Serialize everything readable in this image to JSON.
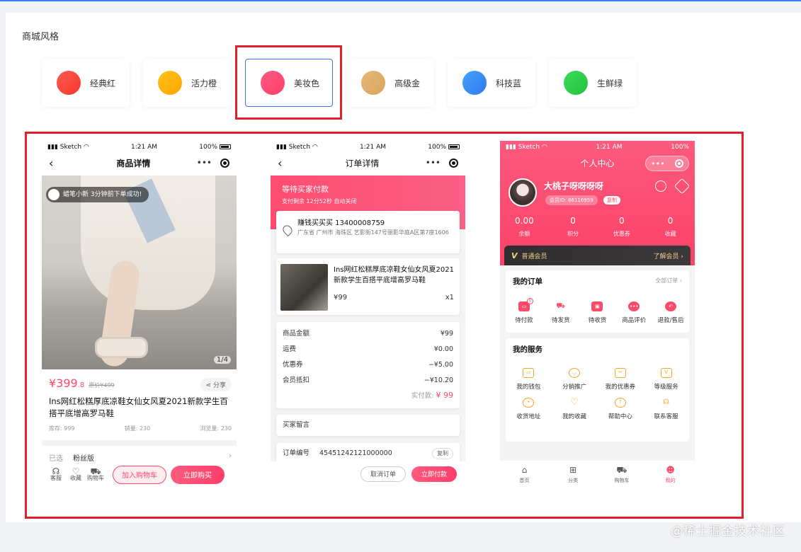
{
  "section_title": "商城风格",
  "themes": [
    {
      "name": "经典红",
      "color": "#f5392f",
      "color2": "#ff5a4e"
    },
    {
      "name": "活力橙",
      "color": "#ffa600",
      "color2": "#ffc21a"
    },
    {
      "name": "美妆色",
      "color": "#fb3f6a",
      "color2": "#fd5a80"
    },
    {
      "name": "高级金",
      "color": "#d9a45f",
      "color2": "#e6b878"
    },
    {
      "name": "科技蓝",
      "color": "#2f7af0",
      "color2": "#46a3f6"
    },
    {
      "name": "生鲜绿",
      "color": "#1fc43e",
      "color2": "#3ed95a"
    }
  ],
  "selected_theme": "美妆色",
  "phone1": {
    "status": {
      "carrier": "Sketch",
      "time": "1:21 AM",
      "battery": "100%"
    },
    "nav_title": "商品详情",
    "toast": "蜡笔小新 3分钟前下单成功!",
    "pager": "1/4",
    "price_main": "¥399",
    "price_dec": ".8",
    "orig_price": "原价¥499",
    "share": "分享",
    "title": "Ins网红松糕厚底凉鞋女仙女风夏2021新款学生百搭平底增高罗马鞋",
    "stock": "库存: 999",
    "sales": "销量: 230",
    "views": "浏览量: 230",
    "selected_label": "已选",
    "selected_value": "粉丝版",
    "bottom": {
      "service": "客服",
      "fav": "收藏",
      "cart": "购物车",
      "add_cart": "加入购物车",
      "buy": "立即购买"
    }
  },
  "phone2": {
    "status": {
      "carrier": "Sketch",
      "time": "1:21 AM",
      "battery": "100%"
    },
    "nav_title": "订单详情",
    "header_title": "等待买家付款",
    "header_sub": "支付剩余 12分52秒 自动关闭",
    "buyer": "赚钱买买买  13400008759",
    "address": "广东省 广州市 海珠区 艺影街147号丽影华庭A区第7座1606",
    "goods_title": "Ins网红松糕厚底凉鞋女仙女风夏2021新款学生百搭平底增高罗马鞋",
    "goods_price": "¥99",
    "goods_qty": "x1",
    "fees": [
      {
        "label": "商品金额",
        "value": "¥99"
      },
      {
        "label": "运费",
        "value": "¥0.00"
      },
      {
        "label": "优惠券",
        "value": "−¥5.00"
      },
      {
        "label": "会员抵扣",
        "value": "−¥10.20"
      }
    ],
    "total_label": "实付款: ",
    "total_value": "¥ 99",
    "message_label": "买家留言",
    "order_no_label": "订单编号",
    "order_no": "45451242121000000",
    "copy": "复制",
    "cancel": "取消订单",
    "pay": "立即付款"
  },
  "phone3": {
    "status": {
      "carrier": "Sketch",
      "time": "1:21 AM",
      "battery": "100%"
    },
    "nav_title": "个人中心",
    "username": "大桃子呀呀呀呀",
    "member_id": "会员ID: 86116959",
    "copy": "复制",
    "assets": [
      {
        "value": "0.00",
        "label": "余额"
      },
      {
        "value": "0",
        "label": "积分"
      },
      {
        "value": "0",
        "label": "优惠券"
      },
      {
        "value": "0",
        "label": "收藏"
      }
    ],
    "vip_label": "普通会员",
    "vip_more": "了解会员 ›",
    "orders_title": "我的订单",
    "orders_more": "全部订单 ›",
    "orders": [
      "待付款",
      "待发货",
      "待收货",
      "商品评价",
      "退款/售后"
    ],
    "orders_badge": "5",
    "services_title": "我的服务",
    "services": [
      "我的钱包",
      "分销推广",
      "我的优惠券",
      "等级服务",
      "收货地址",
      "我的收藏",
      "帮助中心",
      "联系客服"
    ],
    "tabs": [
      "首页",
      "分类",
      "购物车",
      "我的"
    ]
  },
  "watermark": "@稀土掘金技术社区"
}
